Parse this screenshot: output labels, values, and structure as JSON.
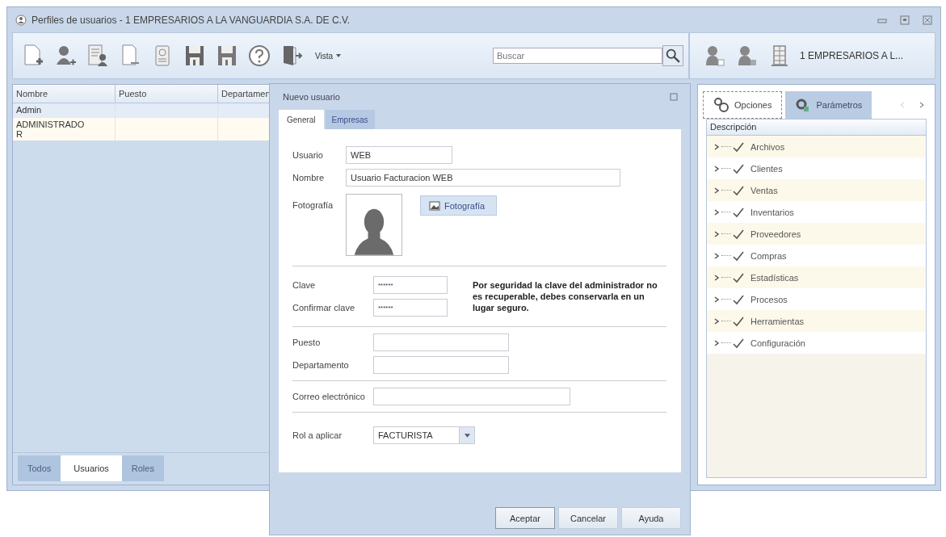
{
  "window": {
    "title": "Perfiles de usuarios - 1 EMPRESARIOS A LA VANGUARDIA S.A. DE C.V."
  },
  "toolbar": {
    "view_menu": "Vista",
    "search": {
      "placeholder": "Buscar"
    }
  },
  "company_toolbar": {
    "company": "1 EMPRESARIOS A L..."
  },
  "users_table": {
    "columns": [
      "Nombre",
      "Puesto",
      "Departamen"
    ],
    "rows": [
      {
        "name": "Admin",
        "selected": true
      },
      {
        "name": "ADMINISTRADOR",
        "selected": false
      }
    ]
  },
  "filter_tabs": [
    {
      "label": "Todos",
      "selected": false
    },
    {
      "label": "Usuarios",
      "selected": true
    },
    {
      "label": "Roles",
      "selected": false
    }
  ],
  "dialog": {
    "title": "Nuevo usuario",
    "tabs": [
      {
        "label": "General",
        "selected": true
      },
      {
        "label": "Empresas",
        "selected": false
      }
    ],
    "user": {
      "label": "Usuario",
      "value": "WEB"
    },
    "name": {
      "label": "Nombre",
      "value": "Usuario Facturacion WEB"
    },
    "photo": {
      "label": "Fotografía",
      "button": "Fotografía"
    },
    "password": {
      "label": "Clave",
      "value": "******"
    },
    "confirm": {
      "label": "Confirmar clave",
      "value": "******"
    },
    "note": "Por seguridad la clave del administrador no es recuperable, debes conservarla en un lugar seguro.",
    "position": {
      "label": "Puesto"
    },
    "department": {
      "label": "Departamento"
    },
    "email": {
      "label": "Correo electrónico"
    },
    "role": {
      "label": "Rol a aplicar",
      "value": "FACTURISTA"
    },
    "buttons": [
      "Aceptar",
      "Cancelar",
      "Ayuda"
    ]
  },
  "options_panel": {
    "tabs": [
      {
        "label": "Opciones",
        "selected": true
      },
      {
        "label": "Parámetros",
        "selected": false
      }
    ],
    "header": "Descripción",
    "items": [
      {
        "label": "Archivos",
        "checked": true,
        "expanded": false
      },
      {
        "label": "Clientes",
        "checked": true,
        "expanded": false
      },
      {
        "label": "Ventas",
        "checked": true,
        "expanded": false
      },
      {
        "label": "Inventarios",
        "checked": true,
        "expanded": false
      },
      {
        "label": "Proveedores",
        "checked": true,
        "expanded": false
      },
      {
        "label": "Compras",
        "checked": true,
        "expanded": false
      },
      {
        "label": "Estadísticas",
        "checked": true,
        "expanded": false
      },
      {
        "label": "Procesos",
        "checked": true,
        "expanded": false
      },
      {
        "label": "Herramientas",
        "checked": true,
        "expanded": false
      },
      {
        "label": "Configuración",
        "checked": true,
        "expanded": false
      }
    ]
  }
}
